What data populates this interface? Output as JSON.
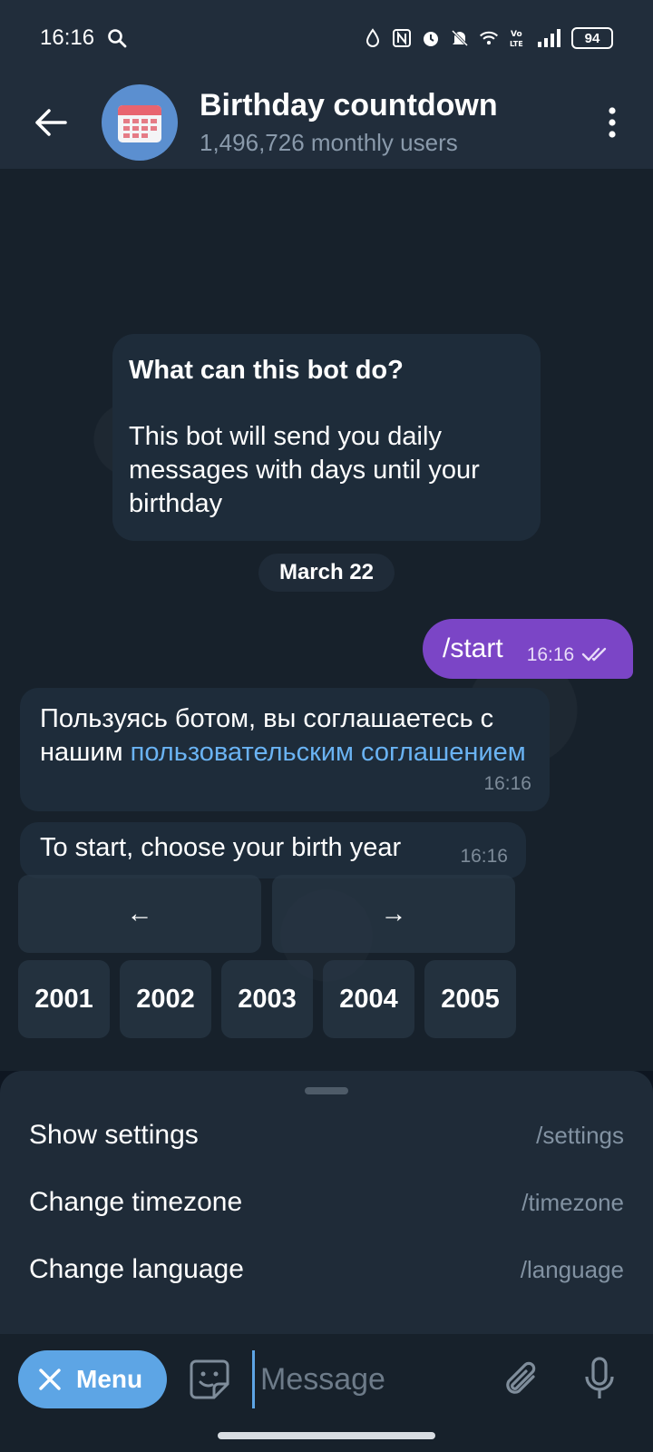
{
  "status_bar": {
    "time": "16:16",
    "battery": "94",
    "icons": [
      "search-icon",
      "drop-icon",
      "nfc-icon",
      "alarm-icon",
      "mute-icon",
      "wifi-icon",
      "volte-icon",
      "signal-icon",
      "battery-icon"
    ]
  },
  "header": {
    "title": "Birthday countdown",
    "subtitle": "1,496,726 monthly users",
    "icons": [
      "back-arrow-icon",
      "calendar-icon",
      "more-vertical-icon"
    ]
  },
  "intro": {
    "title": "What can this bot do?",
    "body": "This bot will send you daily messages with days until your birthday"
  },
  "date_separator": "March 22",
  "messages": {
    "outgoing": {
      "text": "/start",
      "time": "16:16"
    },
    "agreement": {
      "text": "Пользуясь ботом, вы соглашаетесь с нашим ",
      "link": "пользовательским соглашением",
      "time": "16:16"
    },
    "prompt": {
      "text": "To start, choose your birth year",
      "time": "16:16"
    }
  },
  "keyboard": {
    "prev": "←",
    "next": "→",
    "years": [
      "2001",
      "2002",
      "2003",
      "2004",
      "2005"
    ]
  },
  "commands": [
    {
      "label": "Show settings",
      "command": "/settings"
    },
    {
      "label": "Change timezone",
      "command": "/timezone"
    },
    {
      "label": "Change language",
      "command": "/language"
    }
  ],
  "input_bar": {
    "menu_label": "Menu",
    "placeholder": "Message"
  },
  "colors": {
    "accent": "#5da5e5",
    "outgoing_bubble": "#7b45c6",
    "link": "#6ab3f3"
  }
}
